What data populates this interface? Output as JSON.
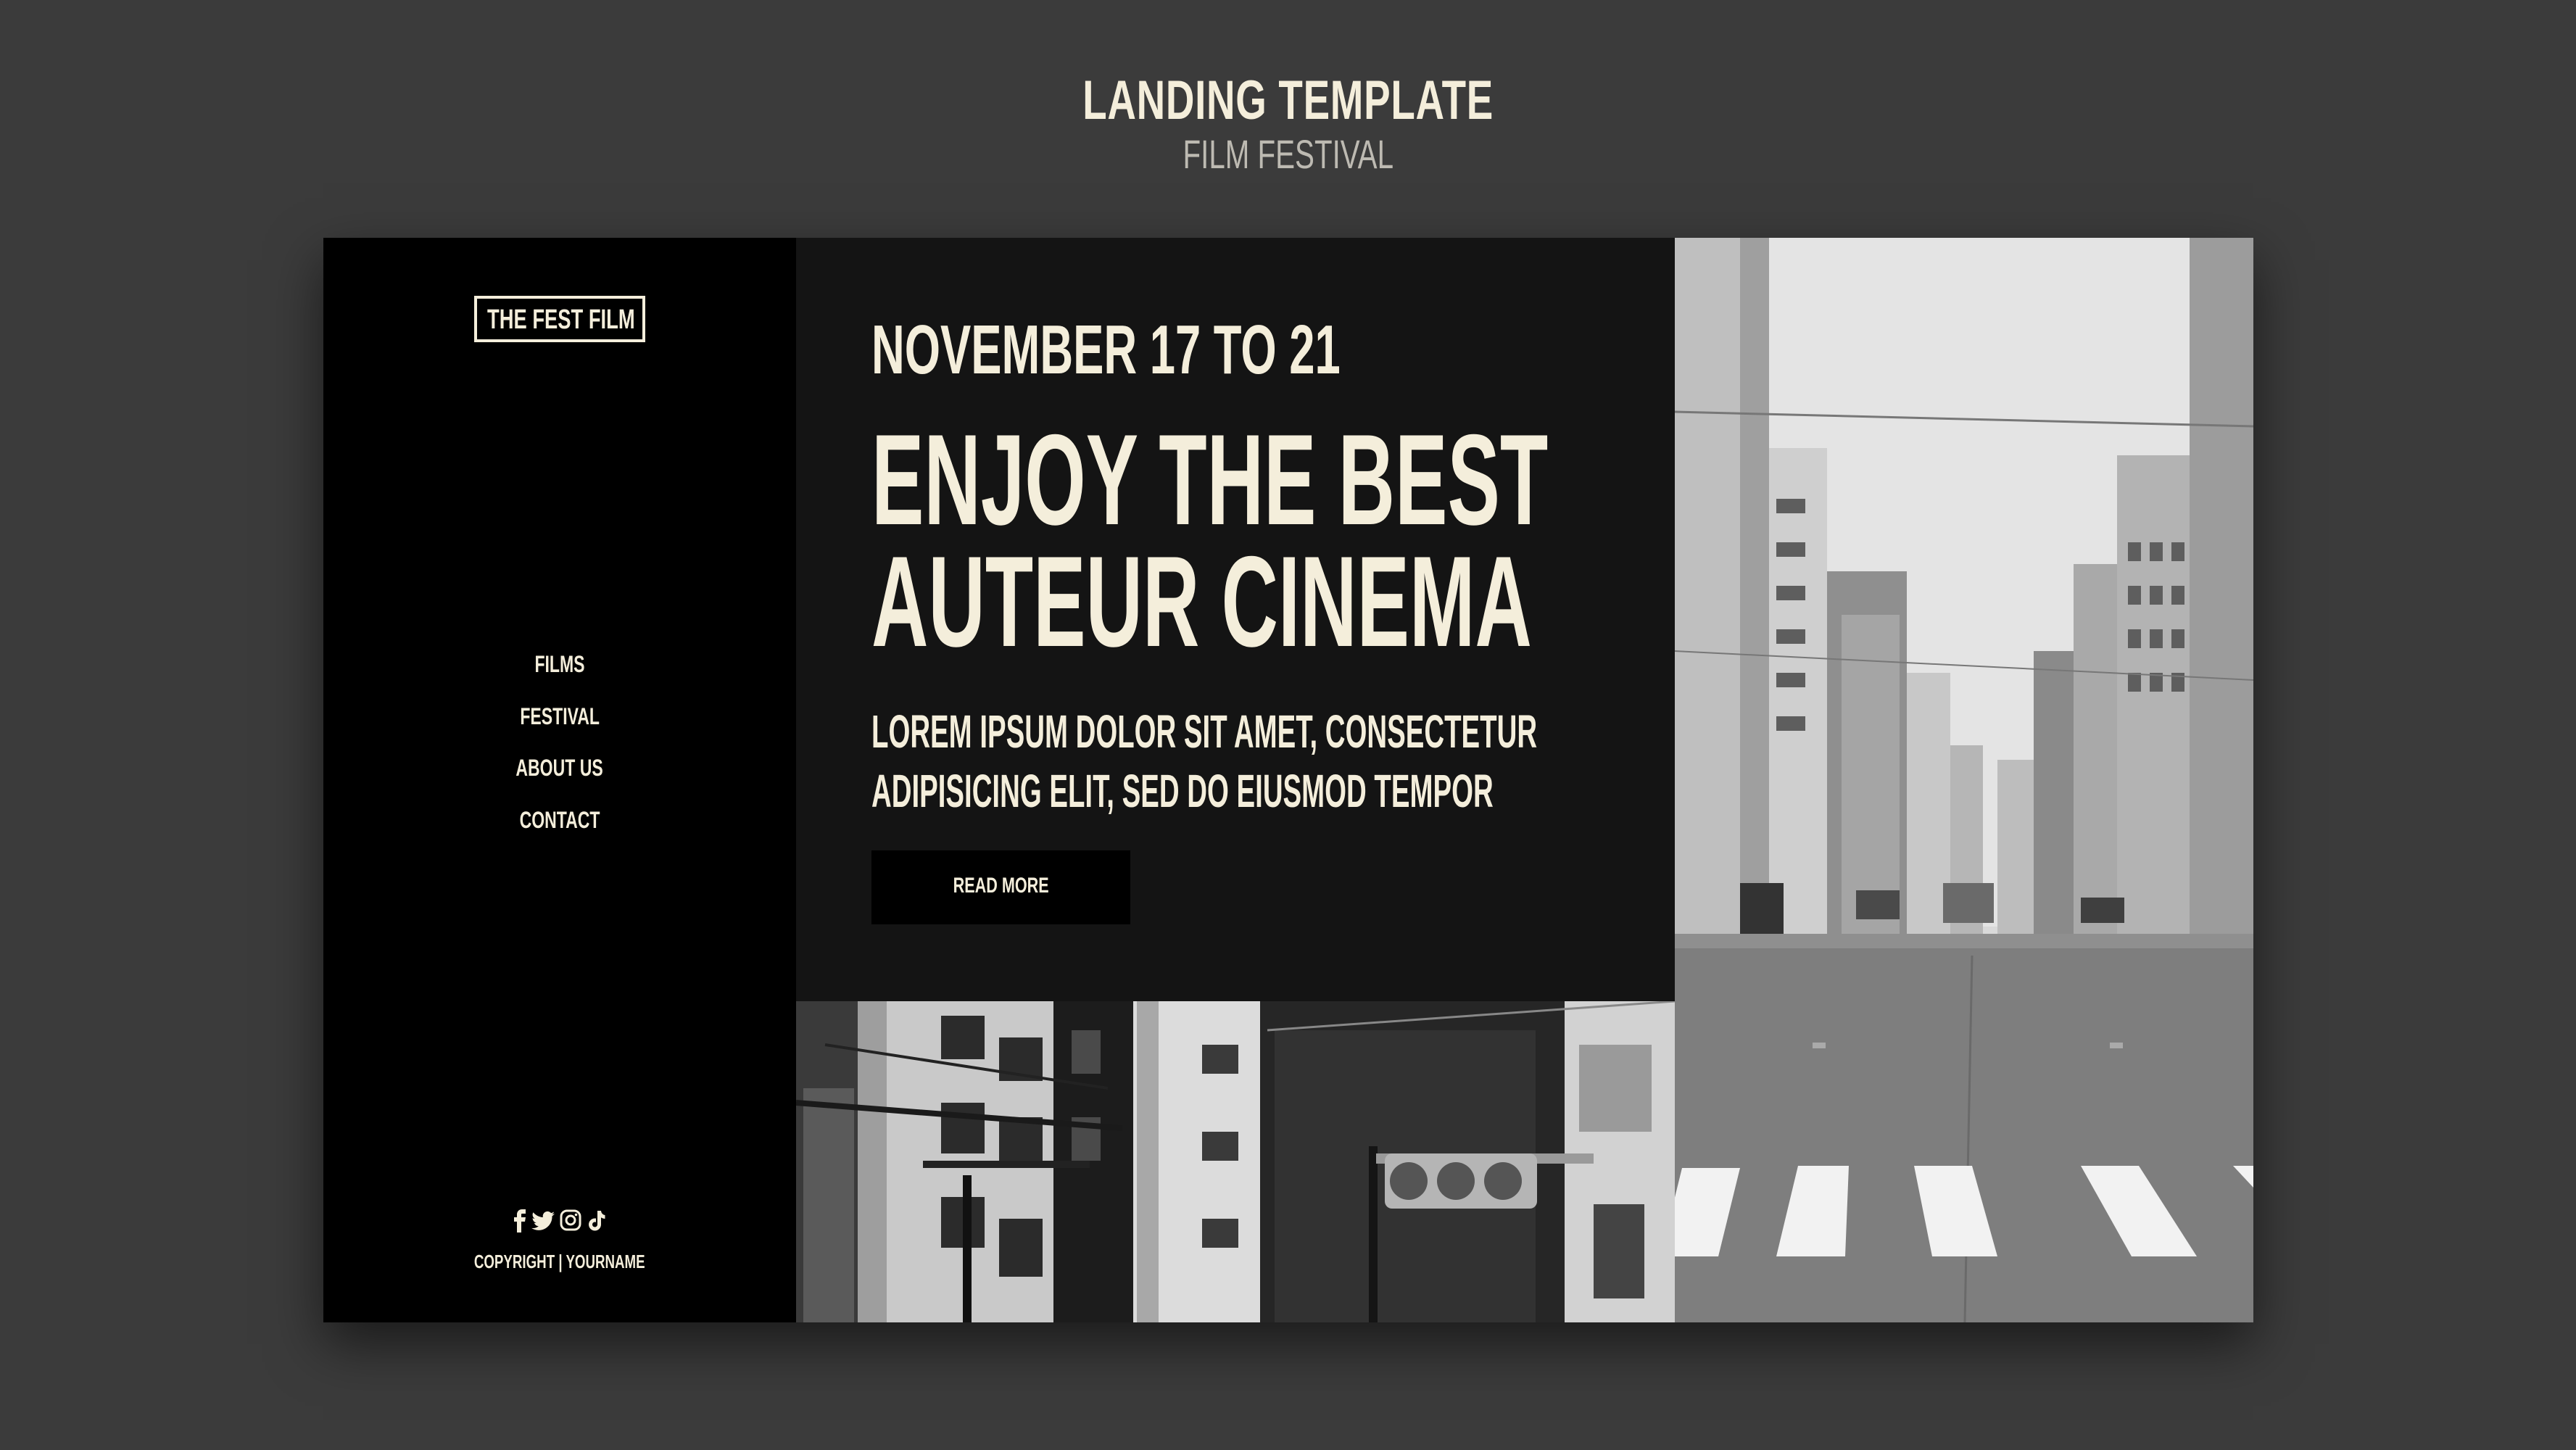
{
  "header": {
    "title": "LANDING TEMPLATE",
    "subtitle": "FILM FESTIVAL"
  },
  "sidebar": {
    "logo": "THE FEST FILM",
    "nav": [
      {
        "label": "FILMS"
      },
      {
        "label": "FESTIVAL"
      },
      {
        "label": "ABOUT US"
      },
      {
        "label": "CONTACT"
      }
    ],
    "socials": [
      "facebook-icon",
      "twitter-icon",
      "instagram-icon",
      "tiktok-icon"
    ],
    "copyright": "COPYRIGHT | YOURNAME"
  },
  "hero": {
    "dates": "NOVEMBER 17 TO 21",
    "headline_line1": "ENJOY THE BEST",
    "headline_line2": "AUTEUR CINEMA",
    "lead_line1": "LOREM IPSUM DOLOR SIT AMET, CONSECTETUR",
    "lead_line2": "ADIPISICING ELIT, SED DO EIUSMOD TEMPOR",
    "button_label": "READ MORE"
  },
  "colors": {
    "page_background": "#3b3b3b",
    "sidebar_background": "#000000",
    "content_background": "#141414",
    "cream_text": "#f4eedb"
  }
}
